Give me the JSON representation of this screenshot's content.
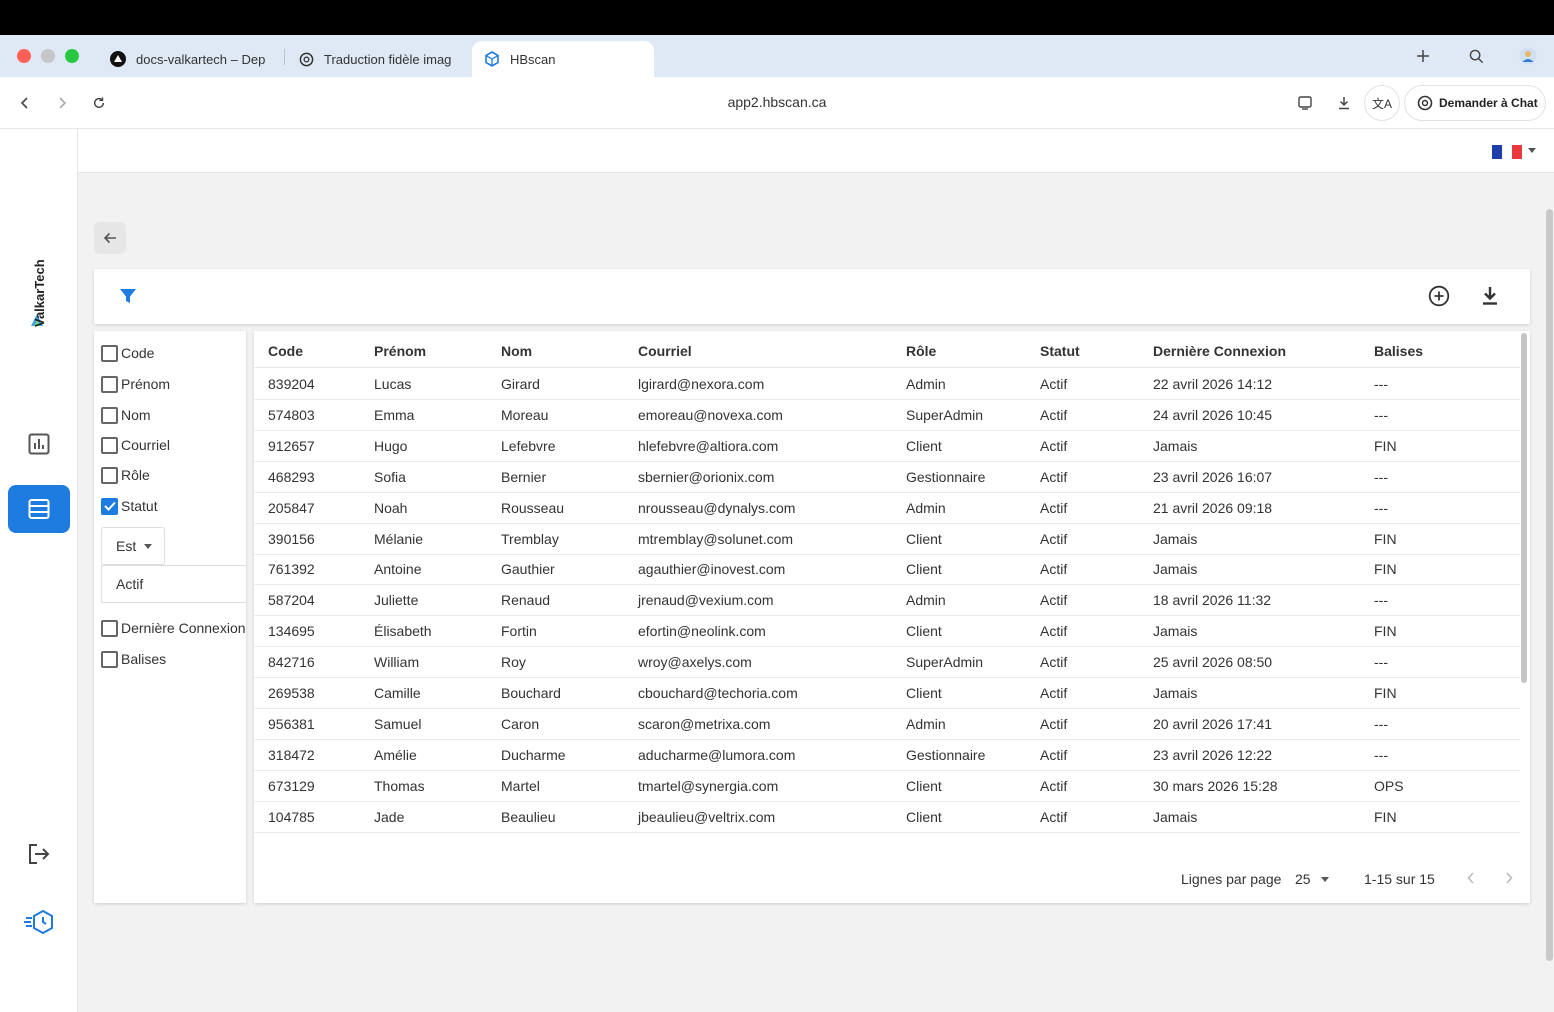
{
  "browser": {
    "tabs": [
      {
        "label": "docs-valkartech – Dep",
        "icon": "vercel-triangle-icon"
      },
      {
        "label": "Traduction fidèle imag",
        "icon": "openai-icon"
      },
      {
        "label": "HBscan",
        "icon": "hbscan-cube-icon"
      }
    ],
    "url": "app2.hbscan.ca",
    "translate_label": "文A",
    "chat_button": "Demander à Chat"
  },
  "app": {
    "brand": "ValkarTech",
    "language": "fr",
    "toolbar": {
      "filter_icon": "filter-icon",
      "add_icon": "add-circle-icon",
      "download_icon": "download-icon"
    },
    "filters": {
      "items": [
        {
          "label": "Code",
          "checked": false
        },
        {
          "label": "Prénom",
          "checked": false
        },
        {
          "label": "Nom",
          "checked": false
        },
        {
          "label": "Courriel",
          "checked": false
        },
        {
          "label": "Rôle",
          "checked": false
        },
        {
          "label": "Statut",
          "checked": true
        },
        {
          "label": "Dernière Connexion",
          "checked": false
        },
        {
          "label": "Balises",
          "checked": false
        }
      ],
      "operator": "Est",
      "value": "Actif"
    },
    "table": {
      "columns": [
        "Code",
        "Prénom",
        "Nom",
        "Courriel",
        "Rôle",
        "Statut",
        "Dernière Connexion",
        "Balises"
      ],
      "rows": [
        [
          "839204",
          "Lucas",
          "Girard",
          "lgirard@nexora.com",
          "Admin",
          "Actif",
          "22 avril 2026 14:12",
          "---"
        ],
        [
          "574803",
          "Emma",
          "Moreau",
          "emoreau@novexa.com",
          "SuperAdmin",
          "Actif",
          "24 avril 2026 10:45",
          "---"
        ],
        [
          "912657",
          "Hugo",
          "Lefebvre",
          "hlefebvre@altiora.com",
          "Client",
          "Actif",
          "Jamais",
          "FIN"
        ],
        [
          "468293",
          "Sofia",
          "Bernier",
          "sbernier@orionix.com",
          "Gestionnaire",
          "Actif",
          "23 avril 2026 16:07",
          "---"
        ],
        [
          "205847",
          "Noah",
          "Rousseau",
          "nrousseau@dynalys.com",
          "Admin",
          "Actif",
          "21 avril 2026 09:18",
          "---"
        ],
        [
          "390156",
          "Mélanie",
          "Tremblay",
          "mtremblay@solunet.com",
          "Client",
          "Actif",
          "Jamais",
          "FIN"
        ],
        [
          "761392",
          "Antoine",
          "Gauthier",
          "agauthier@inovest.com",
          "Client",
          "Actif",
          "Jamais",
          "FIN"
        ],
        [
          "587204",
          "Juliette",
          "Renaud",
          "jrenaud@vexium.com",
          "Admin",
          "Actif",
          "18 avril 2026 11:32",
          "---"
        ],
        [
          "134695",
          "Élisabeth",
          "Fortin",
          "efortin@neolink.com",
          "Client",
          "Actif",
          "Jamais",
          "FIN"
        ],
        [
          "842716",
          "William",
          "Roy",
          "wroy@axelys.com",
          "SuperAdmin",
          "Actif",
          "25 avril 2026 08:50",
          "---"
        ],
        [
          "269538",
          "Camille",
          "Bouchard",
          "cbouchard@techoria.com",
          "Client",
          "Actif",
          "Jamais",
          "FIN"
        ],
        [
          "956381",
          "Samuel",
          "Caron",
          "scaron@metrixa.com",
          "Admin",
          "Actif",
          "20 avril 2026 17:41",
          "---"
        ],
        [
          "318472",
          "Amélie",
          "Ducharme",
          "aducharme@lumora.com",
          "Gestionnaire",
          "Actif",
          "23 avril 2026 12:22",
          "---"
        ],
        [
          "673129",
          "Thomas",
          "Martel",
          "tmartel@synergia.com",
          "Client",
          "Actif",
          "30 mars 2026 15:28",
          "OPS"
        ],
        [
          "104785",
          "Jade",
          "Beaulieu",
          "jbeaulieu@veltrix.com",
          "Client",
          "Actif",
          "Jamais",
          "FIN"
        ]
      ]
    },
    "pagination": {
      "rows_per_page_label": "Lignes par page",
      "rows_per_page": "25",
      "range": "1-15 sur 15"
    },
    "colors": {
      "accent": "#1e7be0",
      "tabbar": "#dfe9f5",
      "background": "#f2f2f2"
    }
  }
}
